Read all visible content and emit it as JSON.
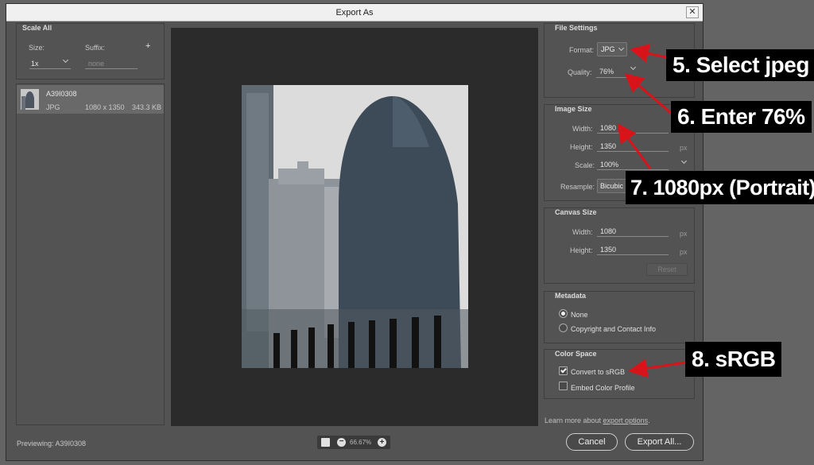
{
  "window": {
    "title": "Export As",
    "close_glyph": "✕"
  },
  "scale_all": {
    "heading": "Scale All",
    "size_label": "Size:",
    "suffix_label": "Suffix:",
    "size_value": "1x",
    "suffix_placeholder": "none",
    "add_glyph": "+"
  },
  "asset": {
    "name": "A39I0308",
    "format": "JPG",
    "dimensions": "1080 x 1350",
    "file_size": "343.3 KB"
  },
  "previewing": "Previewing: A39I0308",
  "zoom": {
    "value": "66.67%",
    "minus": "−",
    "plus": "+"
  },
  "file_settings": {
    "heading": "File Settings",
    "format_label": "Format:",
    "format_value": "JPG",
    "quality_label": "Quality:",
    "quality_value": "76%"
  },
  "image_size": {
    "heading": "Image Size",
    "width_label": "Width:",
    "width_value": "1080",
    "height_label": "Height:",
    "height_value": "1350",
    "scale_label": "Scale:",
    "scale_value": "100%",
    "resample_label": "Resample:",
    "resample_value": "Bicubic",
    "unit": "px"
  },
  "canvas_size": {
    "heading": "Canvas Size",
    "width_label": "Width:",
    "width_value": "1080",
    "height_label": "Height:",
    "height_value": "1350",
    "unit": "px",
    "reset_label": "Reset"
  },
  "metadata": {
    "heading": "Metadata",
    "option_none": "None",
    "option_copyright": "Copyright and Contact Info",
    "selected": "None"
  },
  "color_space": {
    "heading": "Color Space",
    "convert_label": "Convert to sRGB",
    "convert_checked": true,
    "embed_label": "Embed Color Profile",
    "embed_checked": false
  },
  "learn_more": {
    "prefix": "Learn more about ",
    "link": "export options",
    "suffix": "."
  },
  "buttons": {
    "cancel": "Cancel",
    "export": "Export All..."
  },
  "callouts": {
    "step5": "5. Select jpeg",
    "step6": "6. Enter 76%",
    "step7": "7. 1080px (Portrait)",
    "step8": "8. sRGB"
  },
  "colors": {
    "annotation_arrow": "#d8141a",
    "callout_bg": "#000000",
    "panel_bg": "#535353",
    "preview_bg": "#2b2b2b"
  }
}
